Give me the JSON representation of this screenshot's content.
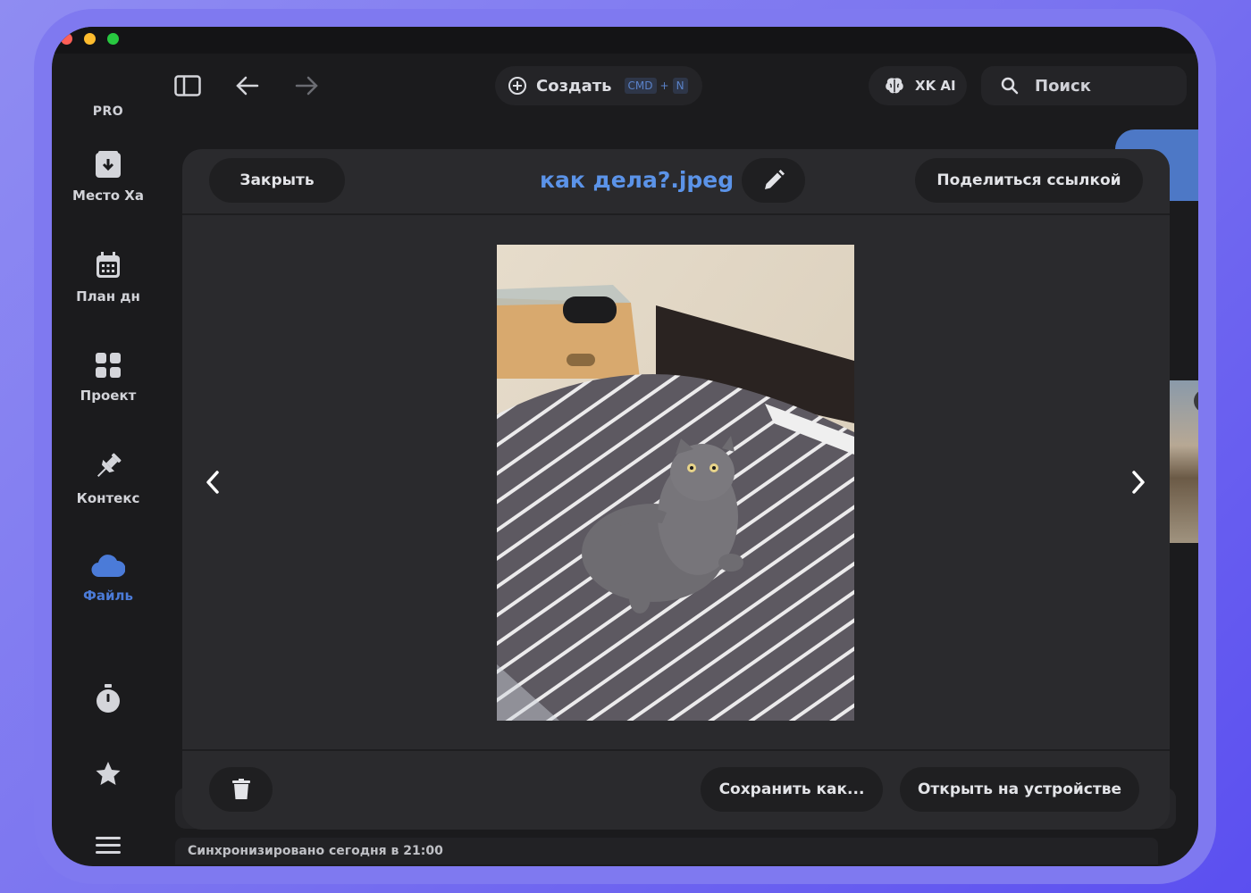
{
  "colors": {
    "accent": "#4b7bd8",
    "filename": "#5b93e8",
    "window_bg": "#1b1b1d",
    "modal_bg": "#2a2a2d",
    "frame": "#7f79f0"
  },
  "sidebar": {
    "plan_badge": "PRO",
    "items": [
      {
        "label": "Место Ха",
        "icon": "inbox-archive-icon"
      },
      {
        "label": "План дн",
        "icon": "calendar-icon"
      },
      {
        "label": "Проект",
        "icon": "grid-icon"
      },
      {
        "label": "Контекс",
        "icon": "pushpin-icon"
      },
      {
        "label": "Файль",
        "icon": "cloud-icon",
        "active": true
      }
    ],
    "bottom_icons": [
      "stopwatch-icon",
      "star-icon",
      "menu-icon"
    ]
  },
  "toolbar": {
    "create_label": "Создать",
    "shortcut_cmd": "CMD",
    "shortcut_plus": "+",
    "shortcut_key": "N",
    "ai_label": "XK AI",
    "search_label": "Поиск"
  },
  "viewer": {
    "close_label": "Закрыть",
    "filename": "как дела?.jpeg",
    "share_label": "Поделиться ссылкой",
    "save_as_label": "Сохранить как...",
    "open_device_label": "Открыть на устройстве"
  },
  "status": {
    "sync_text": "Синхронизировано сегодня в 21:00"
  }
}
